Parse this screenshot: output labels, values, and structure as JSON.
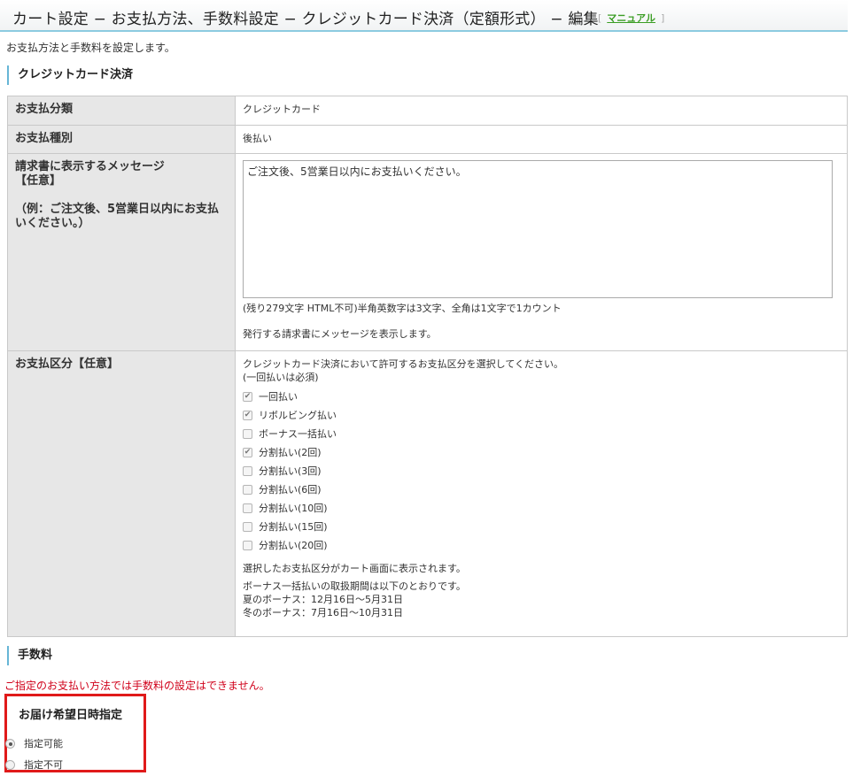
{
  "header": {
    "title": "カート設定 − お支払方法、手数料設定 − クレジットカード決済（定額形式） − 編集",
    "manual_link": "マニュアル"
  },
  "intro": "お支払方法と手数料を設定します。",
  "section_credit": "クレジットカード決済",
  "table": {
    "category_label": "お支払分類",
    "category_value": "クレジットカード",
    "type_label": "お支払種別",
    "type_value": "後払い",
    "message_label": "請求書に表示するメッセージ\n【任意】\n\n（例：ご注文後、5営業日以内にお支払いください。）",
    "message_value": "ご注文後、5営業日以内にお支払いください。",
    "message_hint": "(残り279文字 HTML不可)半角英数字は3文字、全角は1文字で1カウント",
    "message_note": "発行する請求書にメッセージを表示します。",
    "division_label": "お支払区分【任意】",
    "division_intro": "クレジットカード決済において許可するお支払区分を選択してください。\n(一回払いは必須)",
    "divisions": [
      {
        "label": "一回払い",
        "checked": true
      },
      {
        "label": "リボルビング払い",
        "checked": true
      },
      {
        "label": "ボーナス一括払い",
        "checked": false
      },
      {
        "label": "分割払い(2回)",
        "checked": true
      },
      {
        "label": "分割払い(3回)",
        "checked": false
      },
      {
        "label": "分割払い(6回)",
        "checked": false
      },
      {
        "label": "分割払い(10回)",
        "checked": false
      },
      {
        "label": "分割払い(15回)",
        "checked": false
      },
      {
        "label": "分割払い(20回)",
        "checked": false
      }
    ],
    "division_note1": "選択したお支払区分がカート画面に表示されます。",
    "division_note2": "ボーナス一括払いの取扱期間は以下のとおりです。\n夏のボーナス：12月16日～5月31日\n冬のボーナス：7月16日～10月31日"
  },
  "section_fee": "手数料",
  "fee_error": "ご指定のお支払い方法では手数料の設定はできません。",
  "delivery": {
    "title": "お届け希望日時指定",
    "options": [
      {
        "label": "指定可能",
        "selected": true
      },
      {
        "label": "指定不可",
        "selected": false
      }
    ]
  },
  "colors": {
    "accent_border": "#8ccbe0",
    "section_bar": "#67b6d6",
    "manual_link": "#3a9d23",
    "error_text": "#d0021b",
    "highlight_box": "#e01a1a"
  }
}
